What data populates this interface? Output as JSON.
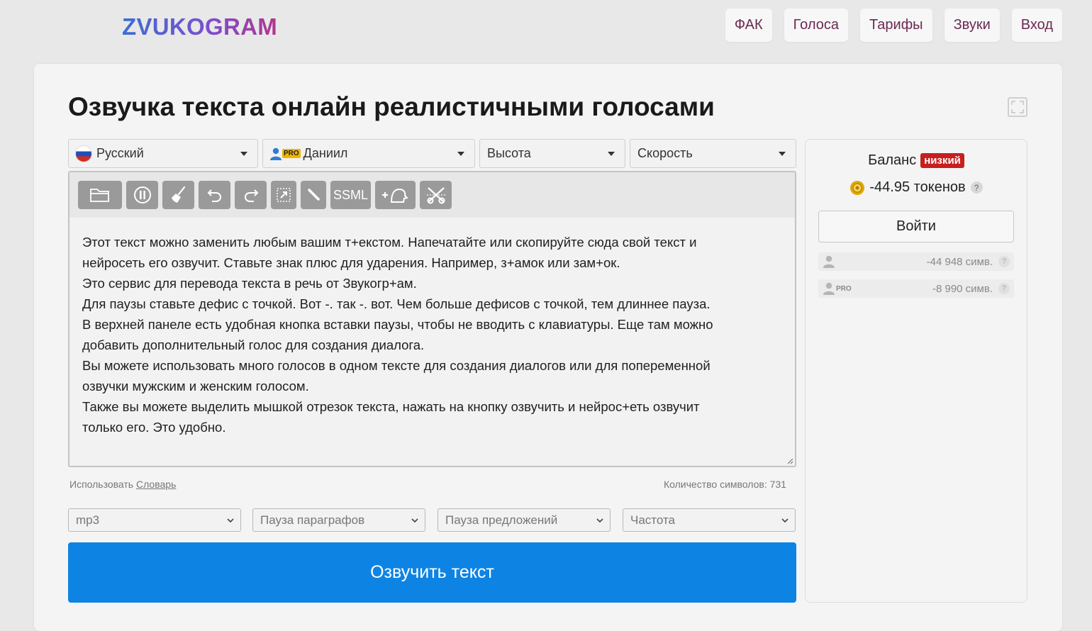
{
  "brand": {
    "name": "ZVUKOGRAM"
  },
  "nav": [
    {
      "label": "ФАК"
    },
    {
      "label": "Голоса"
    },
    {
      "label": "Тарифы"
    },
    {
      "label": "Звуки"
    },
    {
      "label": "Вход"
    }
  ],
  "page": {
    "title": "Озвучка текста онлайн реалистичными голосами"
  },
  "selects": {
    "language": "Русский",
    "voice": "Даниил",
    "voice_badge": "PRO",
    "pitch": "Высота",
    "speed": "Скорость"
  },
  "toolbar": {
    "buttons": [
      "folder-icon",
      "pause-icon",
      "broom-icon",
      "undo-icon",
      "redo-icon",
      "cursor-icon",
      "stress-icon",
      "ssml",
      "add-voice-icon",
      "cut-icon"
    ],
    "ssml_label": "SSML"
  },
  "editor": {
    "lines": [
      "Этот текст можно заменить любым вашим т+екстом. Напечатайте или скопируйте сюда свой текст и",
      "нейросеть его озвучит. Ставьте знак плюс для ударения. Например, з+амок или зам+ок.",
      "Это сервис для перевода текста в речь от Звукогр+ам.",
      "Для паузы ставьте дефис с точкой. Вот -. так -. вот. Чем больше дефисов с точкой, тем длиннее пауза.",
      "В верхней панеле есть удобная кнопка вставки паузы, чтобы не вводить с клавиатуры. Еще там можно",
      "добавить дополнительный голос для создания диалога.",
      "Вы можете использовать много голосов в одном тексте для создания диалогов или для попеременной",
      "озвучки мужским и женским голосом.",
      "Также вы можете выделить мышкой отрезок текста, нажать на кнопку озвучить и нейрос+еть озвучит",
      "только его. Это удобно."
    ]
  },
  "under": {
    "use_label": "Использовать",
    "dictionary_link": "Словарь",
    "char_count": "Количество символов: 731"
  },
  "bottom_selects": {
    "format": "mp3",
    "paragraph_pause": "Пауза параграфов",
    "sentence_pause": "Пауза предложений",
    "frequency": "Частота"
  },
  "speak_button": "Озвучить текст",
  "sidebar": {
    "balance_label": "Баланс",
    "balance_badge": "низкий",
    "tokens": "-44.95 токенов",
    "help": "?",
    "login": "Войти",
    "limits": [
      {
        "value": "-44 948 симв."
      },
      {
        "badge": "PRO",
        "value": "-8 990 симв."
      }
    ]
  },
  "colors": {
    "accent": "#0d84e3",
    "nav_text": "#6b2a50",
    "badge_low": "#c81e1e",
    "pro": "#f0b400"
  }
}
